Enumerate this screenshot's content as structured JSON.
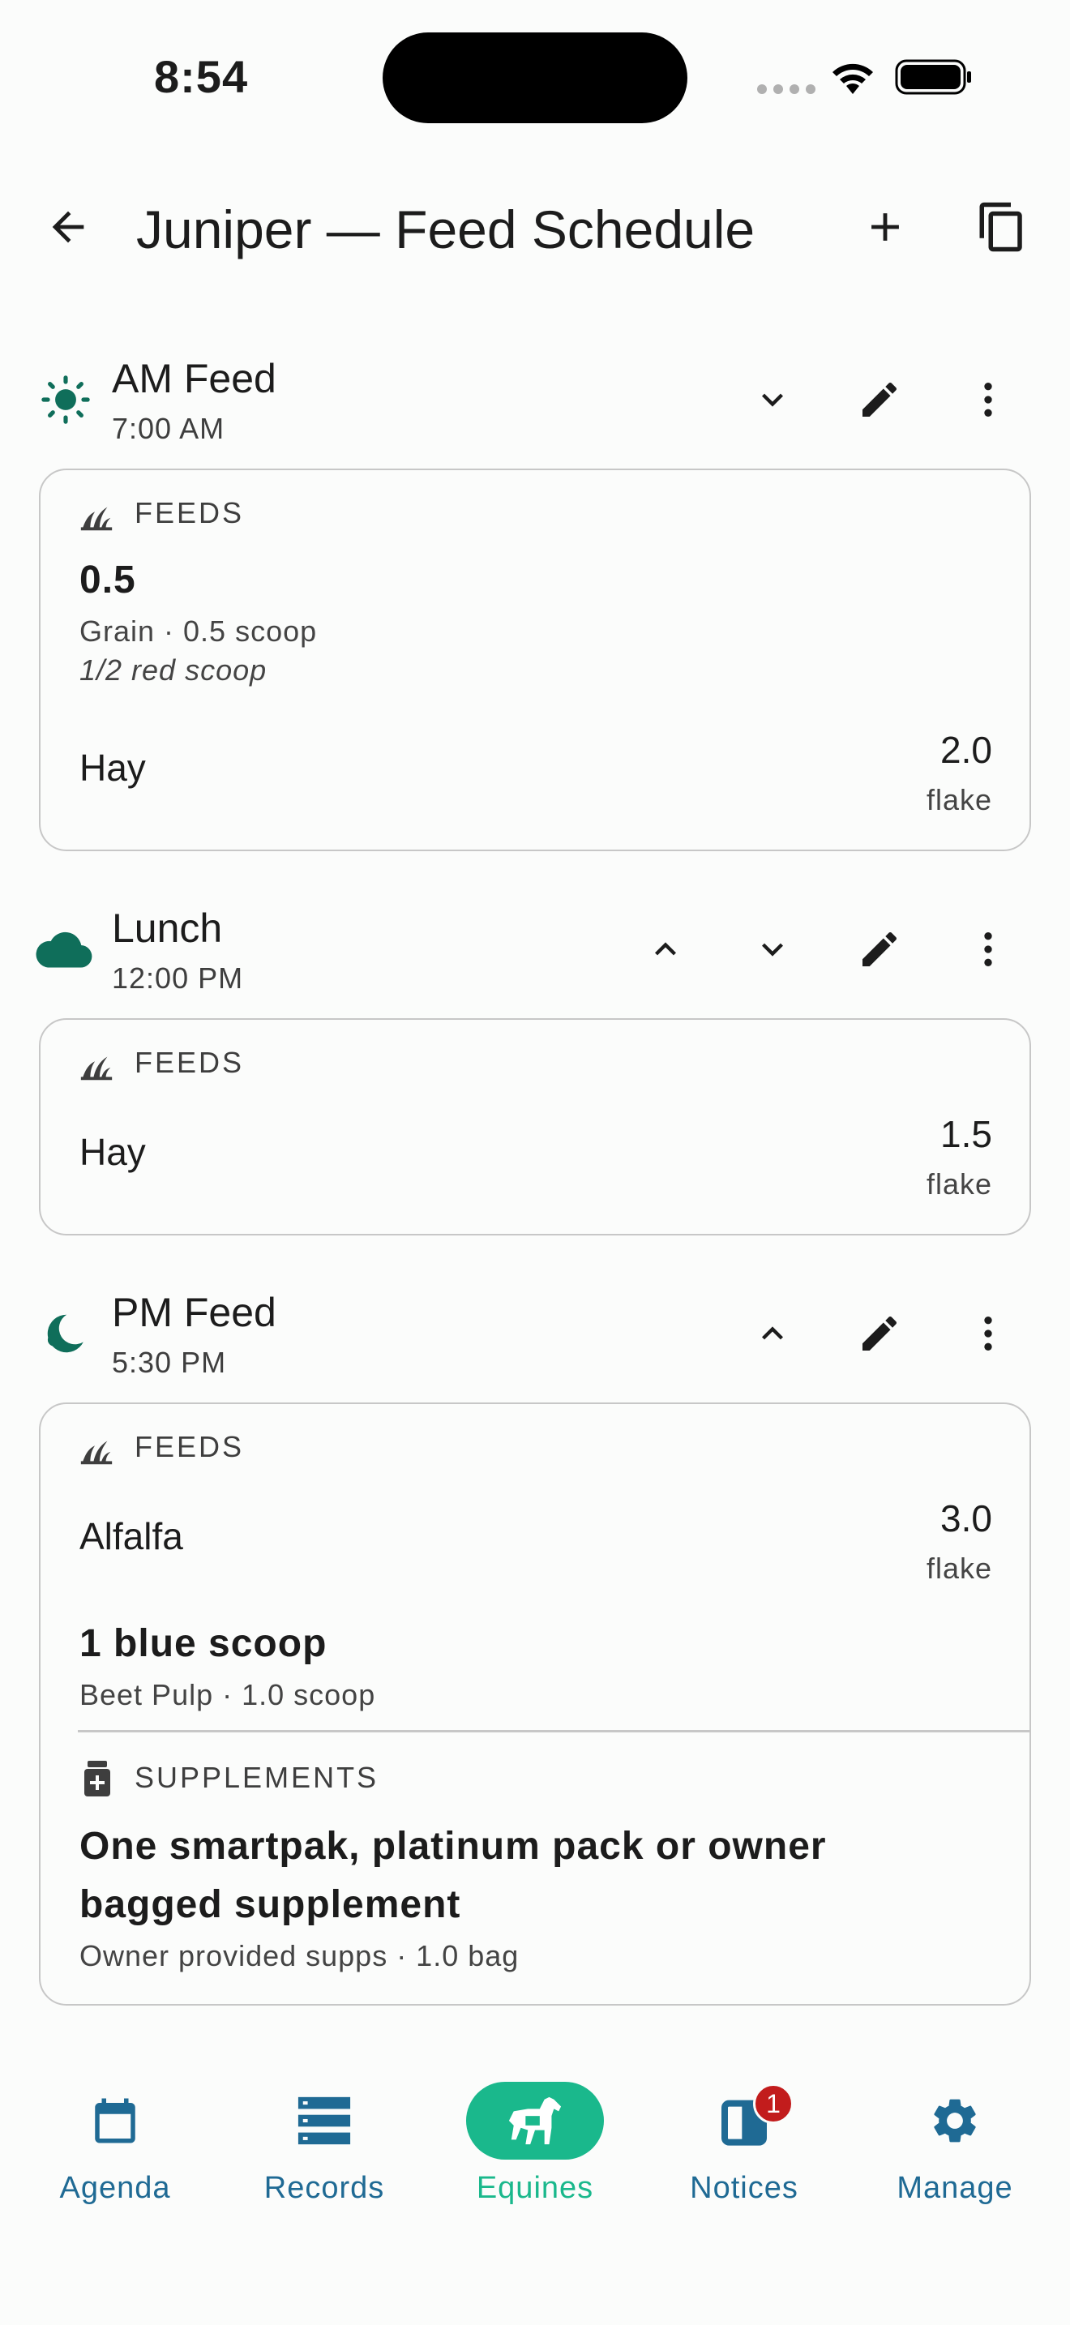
{
  "status_bar": {
    "time": "8:54"
  },
  "app_bar": {
    "title": "Juniper — Feed Schedule"
  },
  "meals": [
    {
      "name": "AM Feed",
      "time": "7:00 AM",
      "icon": "sun-icon",
      "feeds_label": "FEEDS",
      "items": [
        {
          "title": "0.5",
          "sub": "Grain · 0.5 scoop",
          "note": "1/2 red scoop"
        },
        {
          "name": "Hay",
          "qty": "2.0",
          "unit": "flake"
        }
      ]
    },
    {
      "name": "Lunch",
      "time": "12:00 PM",
      "icon": "cloud-icon",
      "feeds_label": "FEEDS",
      "items": [
        {
          "name": "Hay",
          "qty": "1.5",
          "unit": "flake"
        }
      ]
    },
    {
      "name": "PM Feed",
      "time": "5:30 PM",
      "icon": "moon-icon",
      "feeds_label": "FEEDS",
      "items": [
        {
          "name": "Alfalfa",
          "qty": "3.0",
          "unit": "flake"
        },
        {
          "title": "1 blue scoop",
          "sub": "Beet Pulp · 1.0 scoop"
        }
      ],
      "supplements_label": "SUPPLEMENTS",
      "supplements": [
        {
          "title_line1": "One smartpak, platinum pack or owner",
          "title_line2": "bagged supplement",
          "sub": "Owner provided supps · 1.0 bag"
        }
      ]
    }
  ],
  "nav": {
    "items": [
      {
        "label": "Agenda",
        "icon": "calendar-icon"
      },
      {
        "label": "Records",
        "icon": "list-icon"
      },
      {
        "label": "Equines",
        "icon": "horse-icon",
        "active": true
      },
      {
        "label": "Notices",
        "icon": "notice-icon",
        "badge": "1"
      },
      {
        "label": "Manage",
        "icon": "gear-icon"
      }
    ]
  },
  "colors": {
    "accent": "#1ab88c",
    "meal_icon": "#0f6e5a",
    "nav_text": "#1f6a94",
    "badge": "#c21c1c"
  }
}
